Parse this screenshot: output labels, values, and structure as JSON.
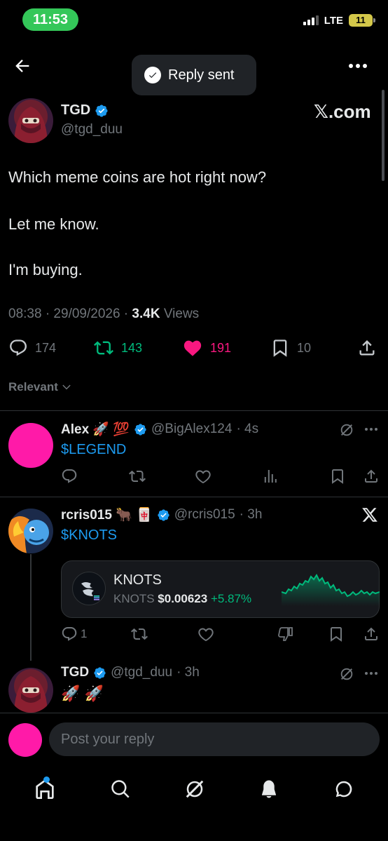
{
  "status_bar": {
    "time": "11:53",
    "network": "LTE",
    "battery": "11"
  },
  "toast": {
    "text": "Reply sent"
  },
  "main_tweet": {
    "name": "TGD",
    "handle": "@tgd_duu",
    "watermark": "𝕏.com",
    "lines": [
      "Which meme coins are hot right now?",
      "Let me know.",
      "I'm buying."
    ],
    "timestamp": "08:38 · 29/09/2026 · ",
    "views_count": "3.4K",
    "views_label": " Views",
    "replies": "174",
    "reposts": "143",
    "likes": "191",
    "bookmarks": "10"
  },
  "sort": {
    "label": "Relevant"
  },
  "replies": [
    {
      "name": "Alex 🚀 💯",
      "handle": "@BigAlex124",
      "time": "· 4s",
      "text": "$LEGEND"
    },
    {
      "name": "rcris015 🐂 🀄",
      "handle": "@rcris015",
      "time": "· 3h",
      "text": "$KNOTS",
      "reply_count": "1",
      "card": {
        "title": "KNOTS",
        "ticker": "KNOTS",
        "price": "$0.00623",
        "change": "+5.87%"
      }
    },
    {
      "name": "TGD",
      "handle": "@tgd_duu",
      "time": "· 3h",
      "text": "🚀 🚀"
    }
  ],
  "composer": {
    "placeholder": "Post your reply"
  },
  "colors": {
    "accent": "#1d9bf0",
    "like": "#f91880",
    "repost": "#00ba7c",
    "bg": "#000000"
  }
}
